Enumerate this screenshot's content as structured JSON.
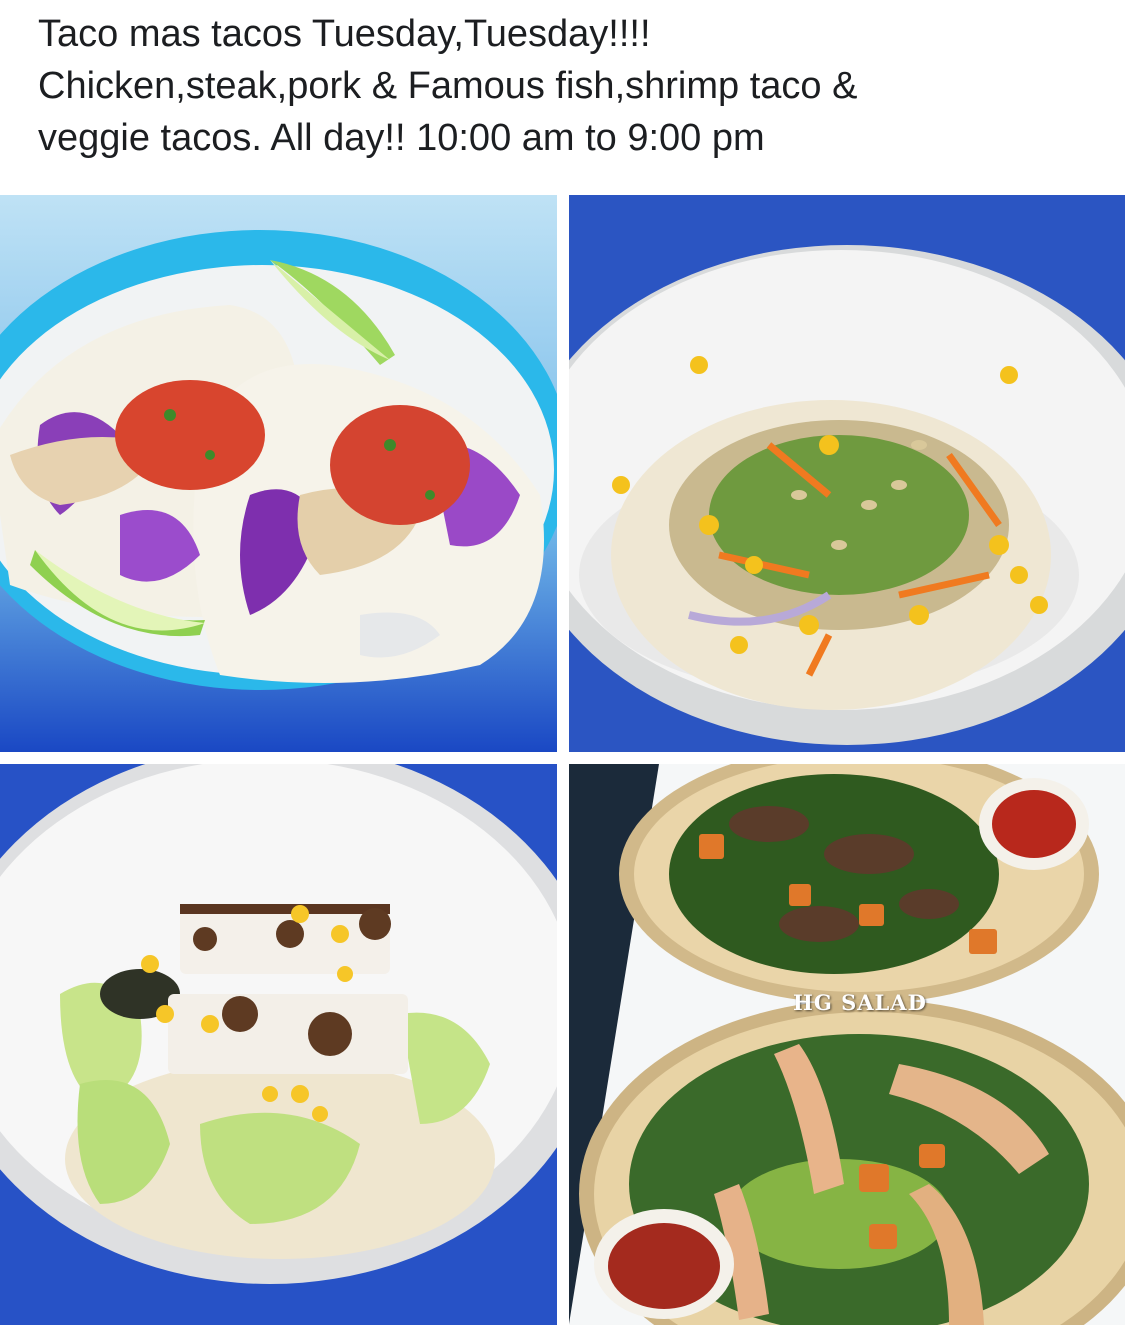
{
  "post": {
    "line1": "Taco mas tacos Tuesday,Tuesday!!!!",
    "line2": "Chicken,steak,pork & Famous fish,shrimp taco &",
    "line3": "veggie tacos. All day!! 10:00 am to 9:00 pm"
  },
  "photos": {
    "salad_watermark": "HG SALAD"
  },
  "colors": {
    "text": "#1c1e21",
    "plate_blue": "#29b6e8",
    "background_blue": "#1e56c8",
    "plate_white": "#f7f7f7",
    "plate_beige": "#e8d3a6"
  }
}
